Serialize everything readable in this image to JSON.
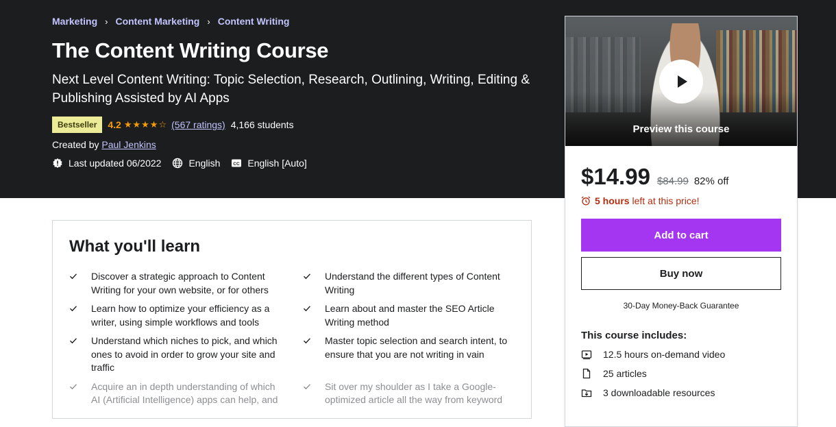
{
  "breadcrumb": [
    "Marketing",
    "Content Marketing",
    "Content Writing"
  ],
  "course": {
    "title": "The Content Writing Course",
    "subtitle": "Next Level Content Writing: Topic Selection, Research, Outlining, Writing, Editing & Publishing Assisted by AI Apps",
    "badge": "Bestseller",
    "rating": "4.2",
    "stars": "★★★★☆",
    "ratings_count": "(567 ratings)",
    "students": "4,166 students",
    "created_by_label": "Created by",
    "author": "Paul Jenkins",
    "last_updated": "Last updated 06/2022",
    "language": "English",
    "captions": "English [Auto]"
  },
  "learn": {
    "title": "What you'll learn",
    "items": [
      "Discover a strategic approach to Content Writing for your own website, or for others",
      "Understand the different types of Content Writing",
      "Learn how to optimize your efficiency as a writer, using simple workflows and tools",
      "Learn about and master the SEO Article Writing method",
      "Understand which niches to pick, and which ones to avoid in order to grow your site and traffic",
      "Master topic selection and search intent, to ensure that you are not writing in vain",
      "Acquire an in depth understanding of which AI (Artificial Intelligence) apps can help, and",
      "Sit over my shoulder as I take a Google-optimized article all the way from keyword"
    ]
  },
  "sidebar": {
    "preview_label": "Preview this course",
    "price": "$14.99",
    "original_price": "$84.99",
    "discount": "82% off",
    "timer_bold": "5 hours",
    "timer_rest": " left at this price!",
    "add_to_cart": "Add to cart",
    "buy_now": "Buy now",
    "guarantee": "30-Day Money-Back Guarantee",
    "includes_title": "This course includes:",
    "includes": [
      {
        "icon": "video-icon",
        "text": "12.5 hours on-demand video"
      },
      {
        "icon": "file-icon",
        "text": "25 articles"
      },
      {
        "icon": "download-icon",
        "text": "3 downloadable resources"
      }
    ]
  },
  "colors": {
    "hero_bg": "#1c1d1f",
    "link_purple": "#c0c4fc",
    "star_orange": "#f69c08",
    "cart_purple": "#a435f0",
    "timer_red": "#b32d0f",
    "badge_yellow": "#eceb98"
  }
}
